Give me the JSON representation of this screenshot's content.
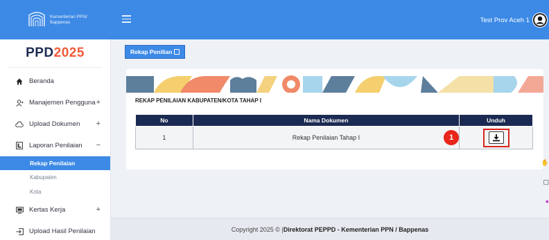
{
  "header": {
    "logo_text_line1": "Kementerian PPN/",
    "logo_text_line2": "Bappenas",
    "user_name": "Test Prov Aceh 1"
  },
  "sidebar": {
    "app_title_prefix": "PPD",
    "app_title_year": "2025",
    "items": [
      {
        "label": "Beranda",
        "icon": "home-icon",
        "right": ""
      },
      {
        "label": "Manajemen Pengguna",
        "icon": "user-manage-icon",
        "right": "+"
      },
      {
        "label": "Upload Dokumen",
        "icon": "cloud-icon",
        "right": "+"
      },
      {
        "label": "Laporan Penilaian",
        "icon": "report-icon",
        "right": "−"
      },
      {
        "label": "Kertas Kerja",
        "icon": "monitor-icon",
        "right": "+"
      },
      {
        "label": "Upload Hasil Penilaian",
        "icon": "upload-icon",
        "right": ""
      }
    ],
    "submenu": {
      "active": "Rekap Penilaian",
      "items": [
        "Kabupaten",
        "Kota"
      ]
    }
  },
  "breadcrumb": {
    "label": "Rekap Penilian"
  },
  "card": {
    "title": "REKAP PENILAIAN KABUPATEN/KOTA TAHAP I",
    "table": {
      "headers": [
        "No",
        "Nama Dokumen",
        "Unduh"
      ],
      "rows": [
        {
          "no": "1",
          "nama": "Rekap Penilaian Tahap I"
        }
      ]
    },
    "badge": "1"
  },
  "footer": {
    "prefix": "Copyright 2025 © |",
    "org": "Direktorat PEPPD - Kementerian PPN / Bappenas"
  },
  "colors": {
    "primary": "#3d8ae6",
    "table_header": "#1b2a52",
    "highlight_red": "#e8261a",
    "year_accent": "#f25a38"
  }
}
